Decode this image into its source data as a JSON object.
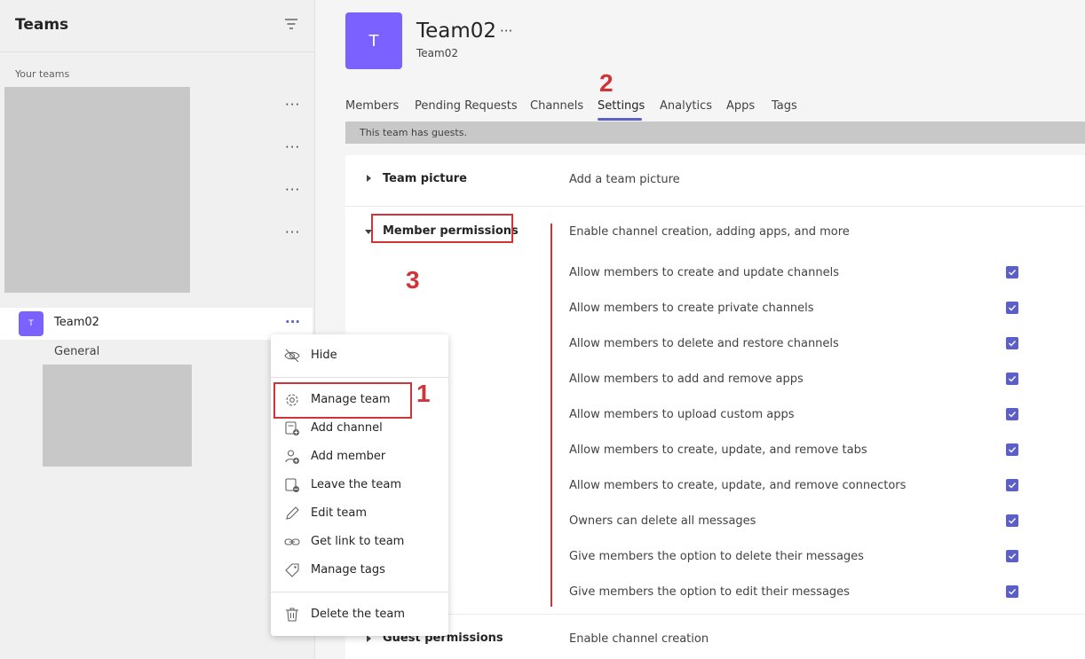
{
  "sidebar": {
    "title": "Teams",
    "section_label": "Your teams",
    "team": {
      "avatar_letter": "T",
      "name": "Team02"
    },
    "channel": "General"
  },
  "context_menu": {
    "items": [
      {
        "label": "Hide",
        "icon": "hide-icon"
      },
      {
        "label": "Manage team",
        "icon": "gear-icon"
      },
      {
        "label": "Add channel",
        "icon": "add-channel-icon"
      },
      {
        "label": "Add member",
        "icon": "add-member-icon"
      },
      {
        "label": "Leave the team",
        "icon": "leave-icon"
      },
      {
        "label": "Edit team",
        "icon": "pencil-icon"
      },
      {
        "label": "Get link to team",
        "icon": "link-icon"
      },
      {
        "label": "Manage tags",
        "icon": "tag-icon"
      },
      {
        "label": "Delete the team",
        "icon": "trash-icon"
      }
    ]
  },
  "header": {
    "avatar_letter": "T",
    "title": "Team02",
    "subtitle": "Team02"
  },
  "tabs": [
    {
      "label": "Members"
    },
    {
      "label": "Pending Requests"
    },
    {
      "label": "Channels"
    },
    {
      "label": "Settings",
      "active": true
    },
    {
      "label": "Analytics"
    },
    {
      "label": "Apps"
    },
    {
      "label": "Tags"
    }
  ],
  "guest_notice": "This team has guests.",
  "settings": {
    "team_picture": {
      "title": "Team picture",
      "description": "Add a team picture"
    },
    "member_permissions": {
      "title": "Member permissions",
      "description": "Enable channel creation, adding apps, and more",
      "items": [
        {
          "label": "Allow members to create and update channels",
          "checked": true
        },
        {
          "label": "Allow members to create private channels",
          "checked": true
        },
        {
          "label": "Allow members to delete and restore channels",
          "checked": true
        },
        {
          "label": "Allow members to add and remove apps",
          "checked": true
        },
        {
          "label": "Allow members to upload custom apps",
          "checked": true
        },
        {
          "label": "Allow members to create, update, and remove tabs",
          "checked": true
        },
        {
          "label": "Allow members to create, update, and remove connectors",
          "checked": true
        },
        {
          "label": "Owners can delete all messages",
          "checked": true
        },
        {
          "label": "Give members the option to delete their messages",
          "checked": true
        },
        {
          "label": "Give members the option to edit their messages",
          "checked": true
        }
      ]
    },
    "guest_permissions": {
      "title": "Guest permissions",
      "description": "Enable channel creation"
    }
  },
  "annotations": {
    "step1": "1",
    "step2": "2",
    "step3": "3"
  },
  "colors": {
    "accent": "#5b5fc7",
    "avatar": "#7b61ff",
    "annotation": "#d13438"
  }
}
